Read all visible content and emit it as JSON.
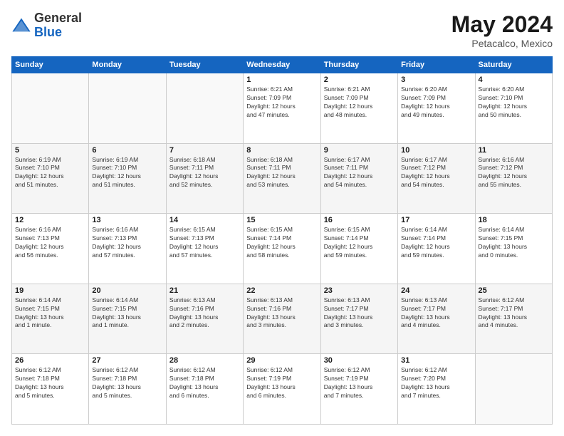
{
  "header": {
    "logo_line1": "General",
    "logo_line2": "Blue",
    "main_title": "May 2024",
    "subtitle": "Petacalco, Mexico"
  },
  "calendar": {
    "days_of_week": [
      "Sunday",
      "Monday",
      "Tuesday",
      "Wednesday",
      "Thursday",
      "Friday",
      "Saturday"
    ],
    "weeks": [
      [
        {
          "day": "",
          "info": ""
        },
        {
          "day": "",
          "info": ""
        },
        {
          "day": "",
          "info": ""
        },
        {
          "day": "1",
          "info": "Sunrise: 6:21 AM\nSunset: 7:09 PM\nDaylight: 12 hours\nand 47 minutes."
        },
        {
          "day": "2",
          "info": "Sunrise: 6:21 AM\nSunset: 7:09 PM\nDaylight: 12 hours\nand 48 minutes."
        },
        {
          "day": "3",
          "info": "Sunrise: 6:20 AM\nSunset: 7:09 PM\nDaylight: 12 hours\nand 49 minutes."
        },
        {
          "day": "4",
          "info": "Sunrise: 6:20 AM\nSunset: 7:10 PM\nDaylight: 12 hours\nand 50 minutes."
        }
      ],
      [
        {
          "day": "5",
          "info": "Sunrise: 6:19 AM\nSunset: 7:10 PM\nDaylight: 12 hours\nand 51 minutes."
        },
        {
          "day": "6",
          "info": "Sunrise: 6:19 AM\nSunset: 7:10 PM\nDaylight: 12 hours\nand 51 minutes."
        },
        {
          "day": "7",
          "info": "Sunrise: 6:18 AM\nSunset: 7:11 PM\nDaylight: 12 hours\nand 52 minutes."
        },
        {
          "day": "8",
          "info": "Sunrise: 6:18 AM\nSunset: 7:11 PM\nDaylight: 12 hours\nand 53 minutes."
        },
        {
          "day": "9",
          "info": "Sunrise: 6:17 AM\nSunset: 7:11 PM\nDaylight: 12 hours\nand 54 minutes."
        },
        {
          "day": "10",
          "info": "Sunrise: 6:17 AM\nSunset: 7:12 PM\nDaylight: 12 hours\nand 54 minutes."
        },
        {
          "day": "11",
          "info": "Sunrise: 6:16 AM\nSunset: 7:12 PM\nDaylight: 12 hours\nand 55 minutes."
        }
      ],
      [
        {
          "day": "12",
          "info": "Sunrise: 6:16 AM\nSunset: 7:13 PM\nDaylight: 12 hours\nand 56 minutes."
        },
        {
          "day": "13",
          "info": "Sunrise: 6:16 AM\nSunset: 7:13 PM\nDaylight: 12 hours\nand 57 minutes."
        },
        {
          "day": "14",
          "info": "Sunrise: 6:15 AM\nSunset: 7:13 PM\nDaylight: 12 hours\nand 57 minutes."
        },
        {
          "day": "15",
          "info": "Sunrise: 6:15 AM\nSunset: 7:14 PM\nDaylight: 12 hours\nand 58 minutes."
        },
        {
          "day": "16",
          "info": "Sunrise: 6:15 AM\nSunset: 7:14 PM\nDaylight: 12 hours\nand 59 minutes."
        },
        {
          "day": "17",
          "info": "Sunrise: 6:14 AM\nSunset: 7:14 PM\nDaylight: 12 hours\nand 59 minutes."
        },
        {
          "day": "18",
          "info": "Sunrise: 6:14 AM\nSunset: 7:15 PM\nDaylight: 13 hours\nand 0 minutes."
        }
      ],
      [
        {
          "day": "19",
          "info": "Sunrise: 6:14 AM\nSunset: 7:15 PM\nDaylight: 13 hours\nand 1 minute."
        },
        {
          "day": "20",
          "info": "Sunrise: 6:14 AM\nSunset: 7:15 PM\nDaylight: 13 hours\nand 1 minute."
        },
        {
          "day": "21",
          "info": "Sunrise: 6:13 AM\nSunset: 7:16 PM\nDaylight: 13 hours\nand 2 minutes."
        },
        {
          "day": "22",
          "info": "Sunrise: 6:13 AM\nSunset: 7:16 PM\nDaylight: 13 hours\nand 3 minutes."
        },
        {
          "day": "23",
          "info": "Sunrise: 6:13 AM\nSunset: 7:17 PM\nDaylight: 13 hours\nand 3 minutes."
        },
        {
          "day": "24",
          "info": "Sunrise: 6:13 AM\nSunset: 7:17 PM\nDaylight: 13 hours\nand 4 minutes."
        },
        {
          "day": "25",
          "info": "Sunrise: 6:12 AM\nSunset: 7:17 PM\nDaylight: 13 hours\nand 4 minutes."
        }
      ],
      [
        {
          "day": "26",
          "info": "Sunrise: 6:12 AM\nSunset: 7:18 PM\nDaylight: 13 hours\nand 5 minutes."
        },
        {
          "day": "27",
          "info": "Sunrise: 6:12 AM\nSunset: 7:18 PM\nDaylight: 13 hours\nand 5 minutes."
        },
        {
          "day": "28",
          "info": "Sunrise: 6:12 AM\nSunset: 7:18 PM\nDaylight: 13 hours\nand 6 minutes."
        },
        {
          "day": "29",
          "info": "Sunrise: 6:12 AM\nSunset: 7:19 PM\nDaylight: 13 hours\nand 6 minutes."
        },
        {
          "day": "30",
          "info": "Sunrise: 6:12 AM\nSunset: 7:19 PM\nDaylight: 13 hours\nand 7 minutes."
        },
        {
          "day": "31",
          "info": "Sunrise: 6:12 AM\nSunset: 7:20 PM\nDaylight: 13 hours\nand 7 minutes."
        },
        {
          "day": "",
          "info": ""
        }
      ]
    ]
  }
}
